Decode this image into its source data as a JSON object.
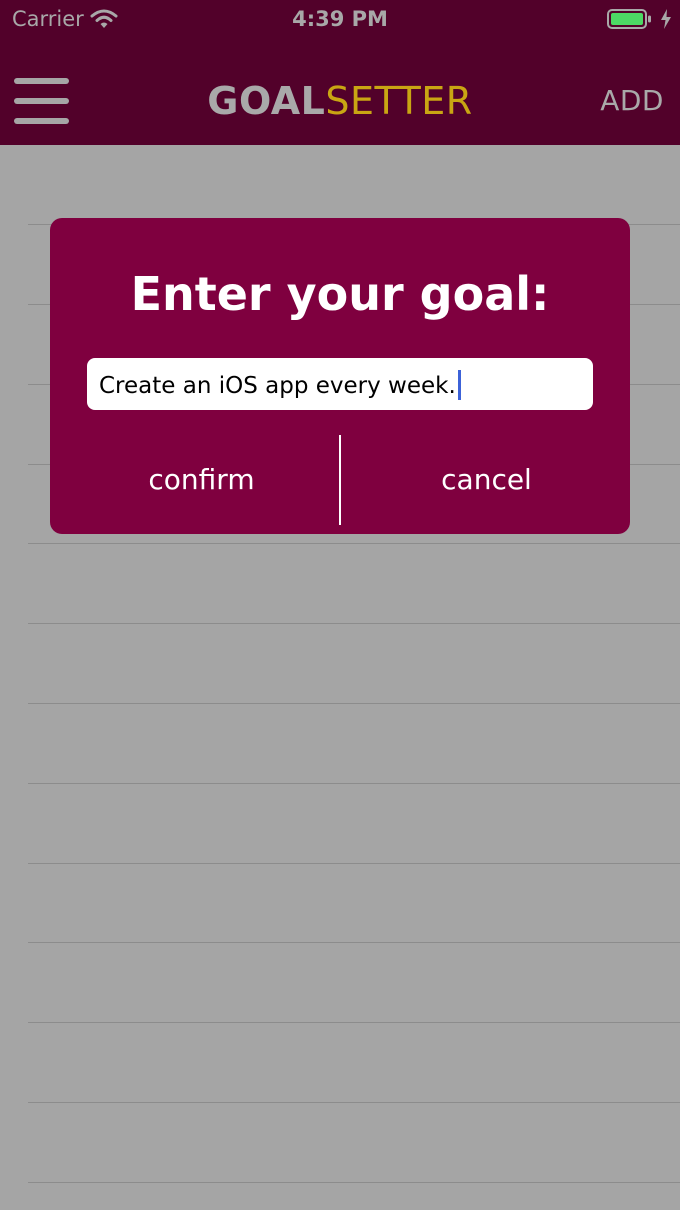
{
  "status_bar": {
    "carrier": "Carrier",
    "time": "4:39 PM"
  },
  "header": {
    "title_part1": "GOAL",
    "title_part2": "SETTER",
    "add_label": "ADD"
  },
  "modal": {
    "title": "Enter your goal:",
    "input_value": "Create an iOS app every week.",
    "confirm_label": "confirm",
    "cancel_label": "cancel"
  },
  "icons": {
    "menu": "menu-icon",
    "wifi": "wifi-icon",
    "battery": "battery-icon",
    "charging": "charging-icon"
  },
  "colors": {
    "header_background": "#52012a",
    "modal_background": "#7f003f",
    "title_accent": "#c9a613",
    "overlay_background": "#a5a5a5",
    "caret": "#3c62d8"
  }
}
